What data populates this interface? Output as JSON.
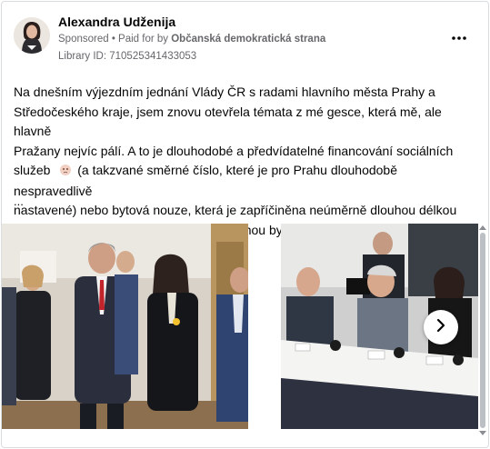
{
  "post": {
    "author": "Alexandra Udženija",
    "sponsored": "Sponsored",
    "paid_for_prefix": " • Paid for by ",
    "sponsor": "Občanská demokratická strana",
    "library_id": "Library ID: 710525341433053",
    "more_icon": "more-horizontal-icon",
    "body_lines": [
      "Na dnešním výjezdním jednání Vlády ČR s radami hlavního města Prahy a",
      "Středočeského kraje, jsem znovu otevřela témata z mé gesce, která mě, ale hlavně",
      "Pražany nejvíc pálí. A to je dlouhodobé a předvídatelné financování sociálních",
      "služeb",
      " (a takzvané směrné číslo, které je pro Prahu dlouhodobě nespravedlivě",
      "nastavené) nebo bytová nouze, která je zapříčiněna neúměrně dlouhou délkou",
      "povolovacích stavebních řízení a neúnosnou byrokracií."
    ],
    "ellipsis": "...",
    "emoji_1": "pleading-face-emoji",
    "emoji_2": "abacus-emoji"
  },
  "carousel": {
    "images": [
      "politicians-talking-photo",
      "meeting-table-photo"
    ],
    "next_icon": "chevron-right-icon"
  },
  "colors": {
    "meta_text": "#65676b",
    "body_text": "#050505",
    "border": "#d9dce1"
  }
}
